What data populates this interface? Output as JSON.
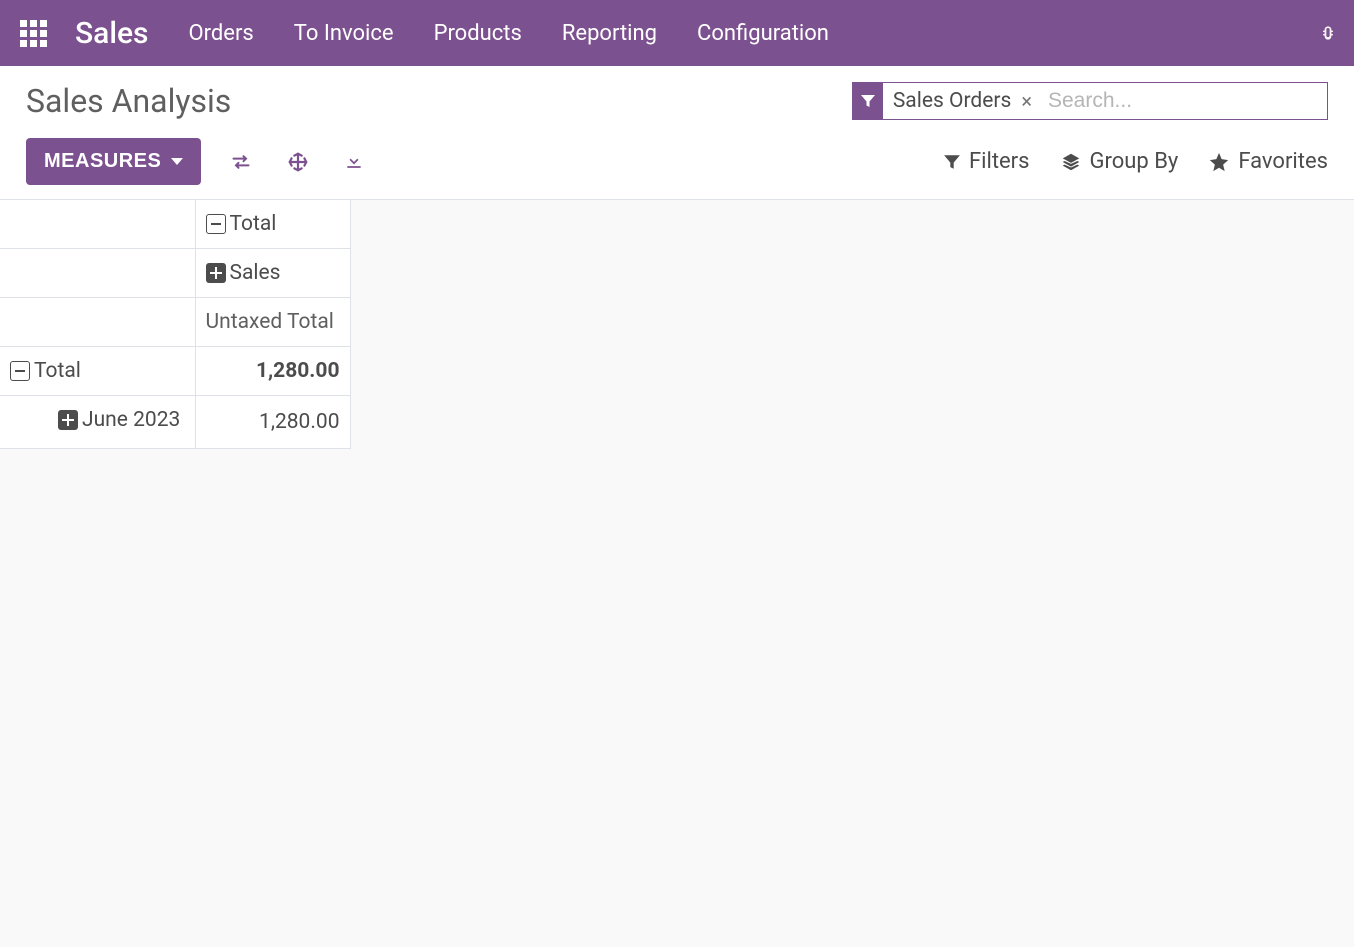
{
  "app_name": "Sales",
  "nav": {
    "orders": "Orders",
    "to_invoice": "To Invoice",
    "products": "Products",
    "reporting": "Reporting",
    "configuration": "Configuration"
  },
  "page_title": "Sales Analysis",
  "search": {
    "facet_label": "Sales Orders",
    "placeholder": "Search..."
  },
  "buttons": {
    "measures": "MEASURES",
    "filters": "Filters",
    "group_by": "Group By",
    "favorites": "Favorites"
  },
  "pivot": {
    "col_total_label": "Total",
    "col_group_label": "Sales",
    "measure_label": "Untaxed Total",
    "row_total_label": "Total",
    "row_group_label": "June 2023",
    "total_value": "1,280.00",
    "row_value": "1,280.00"
  }
}
